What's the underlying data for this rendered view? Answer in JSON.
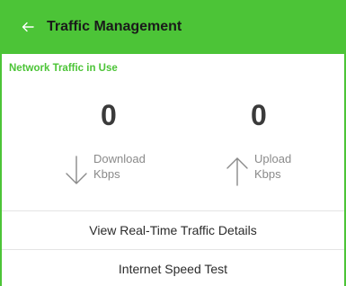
{
  "app_bar": {
    "title": "Traffic Management",
    "back_icon": "arrow-left-icon",
    "background_color": "#4cc437"
  },
  "network": {
    "section_label": "Network Traffic in Use",
    "download": {
      "value": "0",
      "label": "Download",
      "unit": "Kbps",
      "icon": "arrow-down-icon"
    },
    "upload": {
      "value": "0",
      "label": "Upload",
      "unit": "Kbps",
      "icon": "arrow-up-icon"
    }
  },
  "actions": {
    "realtime_details": "View Real-Time Traffic Details",
    "speed_test": "Internet Speed Test"
  }
}
